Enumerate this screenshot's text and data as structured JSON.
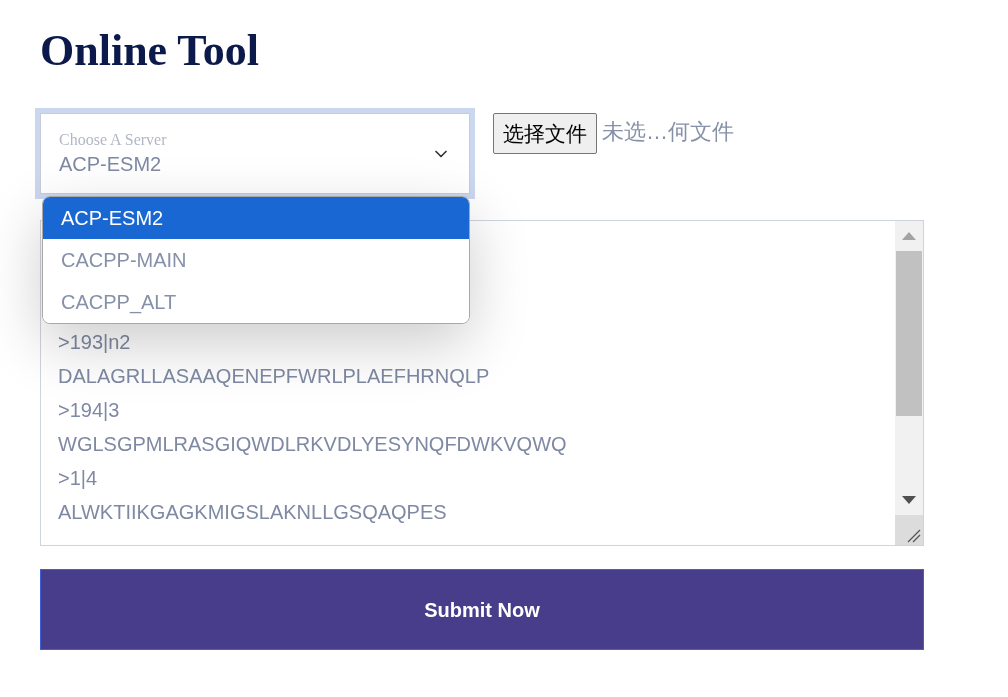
{
  "title": "Online Tool",
  "server_select": {
    "label": "Choose A Server",
    "value": "ACP-ESM2",
    "expanded": true,
    "options": [
      {
        "label": "ACP-ESM2",
        "selected": true
      },
      {
        "label": "CACPP-MAIN",
        "selected": false
      },
      {
        "label": "CACPP_ALT",
        "selected": false
      }
    ]
  },
  "file_input": {
    "button": "选择文件",
    "status": "未选…何文件"
  },
  "sequence_input": {
    "lines": [
      ">193|n2",
      "DALAGRLLASAAQENEPFWRLPLAEFHRNQLP",
      ">194|3",
      "WGLSGPMLRASGIQWDLRKVDLYESYNQFDWKVQWQ",
      ">1|4",
      "ALWKTIIKGAGKMIGSLAKNLLGSQAQPES"
    ]
  },
  "submit_button": "Submit Now"
}
